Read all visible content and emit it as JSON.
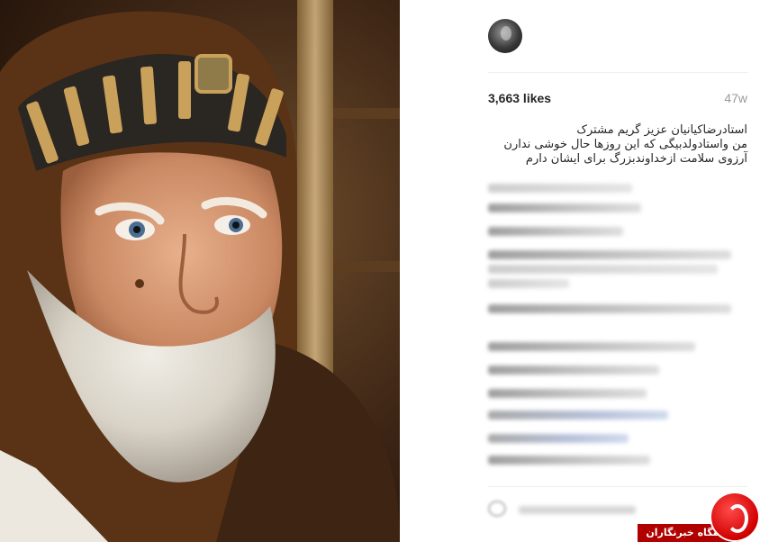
{
  "post": {
    "likes": "3,663 likes",
    "age": "47w",
    "caption_lines": [
      "استادرضاکیانیان عزیز گریم مشترک",
      "من واستادولدبیگی که این روزها حال خوشی ندارن",
      "آرزوی سلامت ازخداوندبزرگ برای ایشان دارم"
    ]
  },
  "watermark": {
    "text": "باشگاه خبرنگاران"
  }
}
